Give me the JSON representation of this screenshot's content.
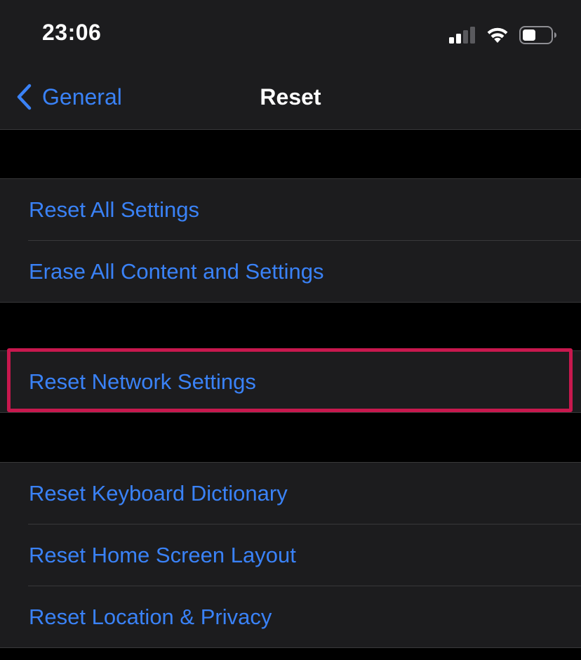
{
  "status_bar": {
    "time": "23:06",
    "icons": [
      "cellular-signal-icon",
      "wifi-icon",
      "battery-icon"
    ]
  },
  "nav": {
    "back_label": "General",
    "back_icon": "chevron-left-icon",
    "title": "Reset"
  },
  "groups": [
    {
      "items": [
        {
          "label": "Reset All Settings"
        },
        {
          "label": "Erase All Content and Settings"
        }
      ]
    },
    {
      "items": [
        {
          "label": "Reset Network Settings",
          "highlighted": true
        }
      ]
    },
    {
      "items": [
        {
          "label": "Reset Keyboard Dictionary"
        },
        {
          "label": "Reset Home Screen Layout"
        },
        {
          "label": "Reset Location & Privacy"
        }
      ]
    }
  ],
  "colors": {
    "background": "#000000",
    "cell": "#1c1c1e",
    "separator": "#38383a",
    "link_blue": "#3a82f7",
    "highlight": "#c8184e",
    "text_primary": "#ffffff"
  }
}
